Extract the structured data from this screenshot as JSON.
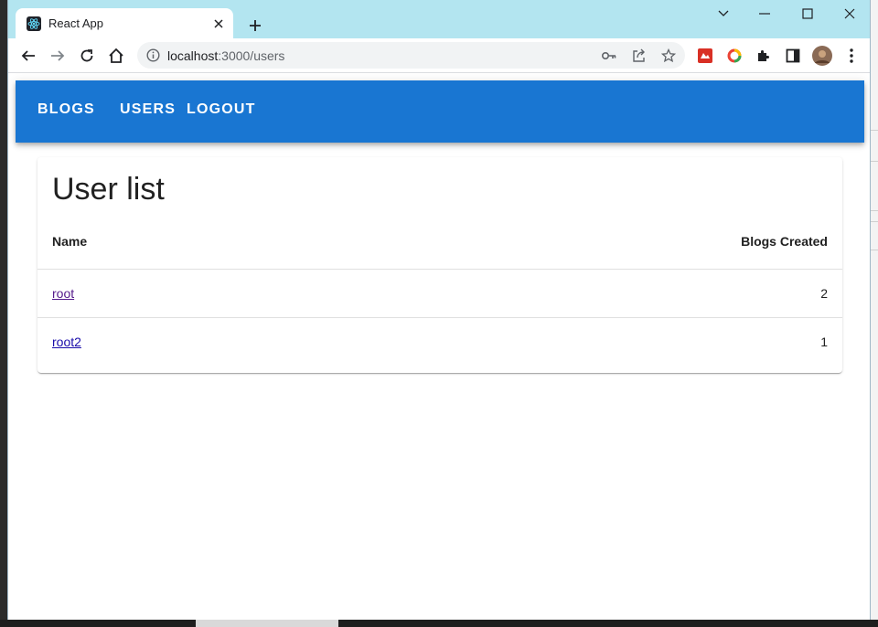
{
  "browser": {
    "tab_title": "React App",
    "url_host": "localhost",
    "url_path": ":3000/users"
  },
  "nav": {
    "blogs_label": "BLOGS",
    "users_label": "USERS",
    "logout_label": "LOGOUT"
  },
  "main": {
    "heading": "User list",
    "columns": [
      "Name",
      "Blogs Created"
    ],
    "rows": [
      {
        "name": "root",
        "blogs": "2"
      },
      {
        "name": "root2",
        "blogs": "1"
      }
    ]
  },
  "colors": {
    "appbar": "#1976d2",
    "tabstrip": "#b3e5f0"
  },
  "icons": [
    "react-favicon-icon",
    "close-icon",
    "plus-icon",
    "chevron-down-icon",
    "minimize-icon",
    "maximize-icon",
    "close-window-icon",
    "back-arrow-icon",
    "forward-arrow-icon",
    "reload-icon",
    "home-icon",
    "info-icon",
    "key-icon",
    "share-icon",
    "star-icon",
    "extension-icon",
    "puzzle-icon",
    "sidepanel-icon",
    "avatar",
    "kebab-menu-icon"
  ]
}
